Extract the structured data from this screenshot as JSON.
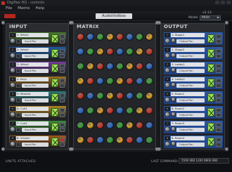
{
  "window": {
    "title": "Digiflex HQ - controls"
  },
  "menu": [
    "File",
    "Matrix",
    "Help"
  ],
  "top": {
    "device_name": "AudioVisitbox",
    "version": "v3.13",
    "model_label": "Model",
    "model_value": "MIXit"
  },
  "sections": {
    "input": "INPUT",
    "matrix": "MATRIX",
    "output": "OUTPUT"
  },
  "inputs": [
    {
      "num": "1",
      "name": "1: Whistl",
      "label": "Input Pan",
      "color": "#4a7a30"
    },
    {
      "num": "2",
      "name": "2: Whistl",
      "label": "Input Pan",
      "color": "#1f5ea8"
    },
    {
      "num": "3",
      "name": "3: Whistl",
      "label": "Input Pan",
      "color": "#7a3aa0"
    },
    {
      "num": "4",
      "name": "4: Keys",
      "label": "Input Pan",
      "color": "#a07020"
    },
    {
      "num": "5",
      "name": "5: Misket4",
      "label": "Input Pan",
      "color": "#2a7a78"
    },
    {
      "num": "6",
      "name": "6: Cuit1",
      "label": "Input Pan",
      "color": "#b08520"
    },
    {
      "num": "7",
      "name": "7: Cuit1",
      "label": "Input Pan",
      "color": "#3f8a3a"
    },
    {
      "num": "8",
      "name": "8: Viewen",
      "label": "Input Pan",
      "color": "#a05a18"
    }
  ],
  "outputs": [
    {
      "num": "1",
      "name": "1: Stage1",
      "label": "Output Pan"
    },
    {
      "num": "2",
      "name": "2: Stage2",
      "label": "Output Pan"
    },
    {
      "num": "3",
      "name": "3: Lobby1",
      "label": "Output Pan"
    },
    {
      "num": "4",
      "name": "4: Lobby2",
      "label": "Output Pan"
    },
    {
      "num": "5",
      "name": "5: Room1",
      "label": "Output Pan"
    },
    {
      "num": "6",
      "name": "6: Room2",
      "label": "Output Pan"
    },
    {
      "num": "7",
      "name": "7: Room3",
      "label": "Output Pan"
    },
    {
      "num": "8",
      "name": "8: Room4",
      "label": "Output Pan"
    }
  ],
  "status": {
    "units_label": "UNITS ATTACHED",
    "last_command_label": "LAST COMMAND:",
    "last_command_value": "5500 0B0 1200 0B00 0B0"
  }
}
